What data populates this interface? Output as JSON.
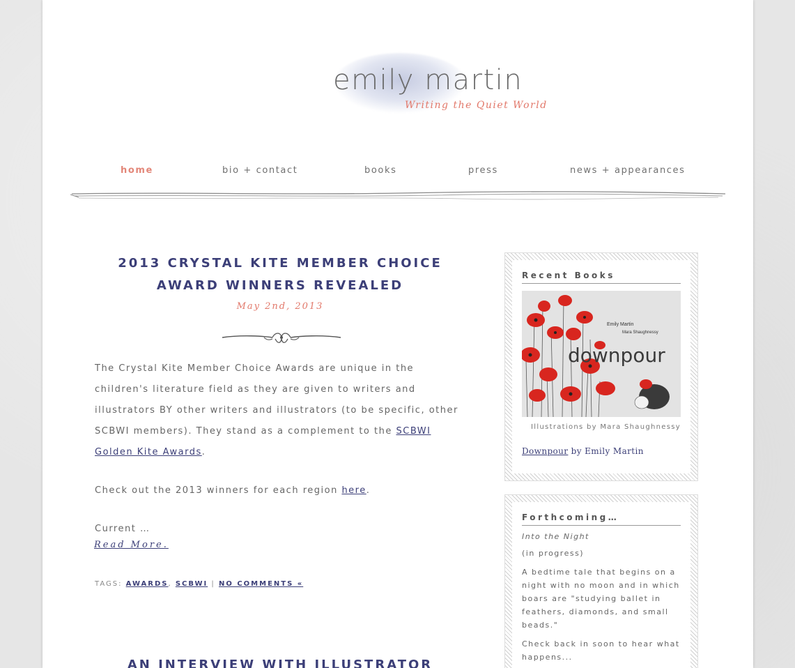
{
  "header": {
    "site_name": "emily martin",
    "tagline": "Writing the Quiet World"
  },
  "nav": {
    "items": [
      {
        "label": "home",
        "active": true
      },
      {
        "label": "bio + contact",
        "active": false
      },
      {
        "label": "books",
        "active": false
      },
      {
        "label": "press",
        "active": false
      },
      {
        "label": "news + appearances",
        "active": false
      }
    ]
  },
  "post": {
    "title_line1": "2013 Crystal Kite Member Choice",
    "title_line2": "Award Winners Revealed",
    "date": "May 2nd, 2013",
    "para1_text": "The Crystal Kite Member Choice Awards are unique in the children's literature field as they are given to writers and illustrators BY other writers and illustrators (to be specific, other SCBWI members). They stand as a complement to the ",
    "para1_link": "SCBWI Golden Kite Awards",
    "para1_end": ".",
    "para2_text": "Check out the 2013 winners for each region ",
    "para2_link": "here",
    "para2_end": ".",
    "para3_text": "Current …",
    "read_more": "Read More.",
    "tags_label": "Tags:",
    "tag1": "awards",
    "tag2": "SCBWI",
    "separator": "|",
    "comments": "No Comments «"
  },
  "post2": {
    "title": "An Interview with Illustrator"
  },
  "sidebar": {
    "recent_books": {
      "title": "Recent Books",
      "cover_author": "Emily Martin",
      "cover_illustrator": "Mara Shaughnessy",
      "cover_title": "downpour",
      "caption": "Illustrations by Mara Shaughnessy",
      "book_link": "Downpour",
      "book_by": " by Emily Martin"
    },
    "forthcoming": {
      "title": "Forthcoming…",
      "book_title": "Into the Night",
      "status": "(in progress)",
      "description": "A bedtime tale that begins on a night with no moon and in which boars are \"studying ballet in feathers, diamonds, and small beads.\"",
      "check_back": "Check back in soon to hear what happens..."
    }
  },
  "colors": {
    "accent_navy": "#3c3f78",
    "accent_coral": "#e2786a",
    "nav_active": "#e38779"
  }
}
